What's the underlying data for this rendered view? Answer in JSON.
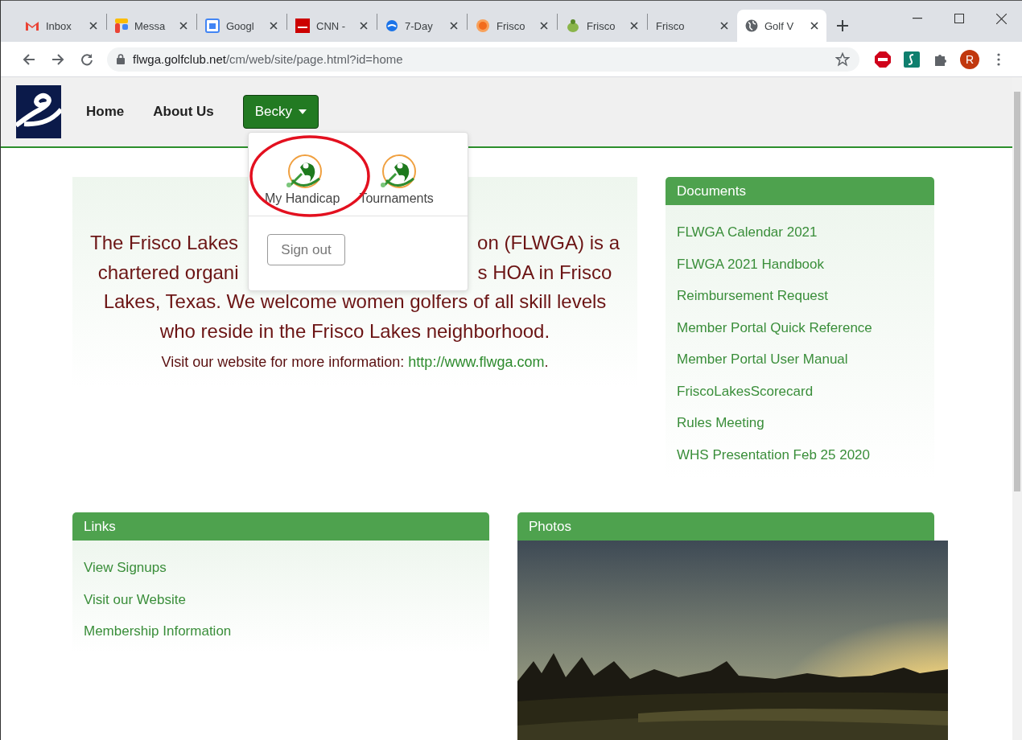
{
  "browser": {
    "tabs": [
      {
        "kind": "gmail",
        "title": "Inbox",
        "selected": false
      },
      {
        "kind": "messages",
        "title": "Messa",
        "selected": false
      },
      {
        "kind": "calendar",
        "title": "Googl",
        "selected": false
      },
      {
        "kind": "cnn",
        "title": "CNN -",
        "selected": false
      },
      {
        "kind": "weather",
        "title": "7-Day",
        "selected": false
      },
      {
        "kind": "sun",
        "title": "Frisco",
        "selected": false
      },
      {
        "kind": "bug",
        "title": "Frisco",
        "selected": false
      },
      {
        "kind": "none",
        "title": "Frisco",
        "selected": false
      },
      {
        "kind": "globe",
        "title": "Golf V",
        "selected": true
      }
    ],
    "address": {
      "host": "flwga.golfclub.net",
      "path": "/cm/web/site/page.html?id=home"
    },
    "profile_initial": "R"
  },
  "nav": {
    "items": [
      "Home",
      "About Us"
    ],
    "user_menu": {
      "label": "Becky",
      "expanded": true,
      "items": [
        {
          "label": "My Handicap",
          "circled": true
        },
        {
          "label": "Tournaments",
          "circled": false
        }
      ],
      "sign_out": "Sign out"
    }
  },
  "intro": {
    "lines": [
      [
        "The Frisco Lakes",
        "on (FLWGA) is a"
      ],
      [
        "chartered organi",
        "s HOA in Frisco"
      ],
      [
        "Lakes, Texas. We welcome women golfers of all skill levels"
      ],
      [
        "who reside in the Frisco Lakes neighborhood."
      ]
    ],
    "visit": {
      "text": "Visit our website for more information: ",
      "link": "http://www.flwga.com",
      "after": "."
    }
  },
  "documents": {
    "title": "Documents",
    "items": [
      "FLWGA Calendar 2021",
      "FLWGA 2021 Handbook",
      "Reimbursement Request",
      "Member Portal Quick Reference",
      "Member Portal User Manual",
      "FriscoLakesScorecard",
      "Rules Meeting",
      "WHS Presentation Feb 25 2020"
    ]
  },
  "links": {
    "title": "Links",
    "items": [
      "View Signups",
      "Visit our Website",
      "Membership Information"
    ]
  },
  "photos": {
    "title": "Photos"
  }
}
